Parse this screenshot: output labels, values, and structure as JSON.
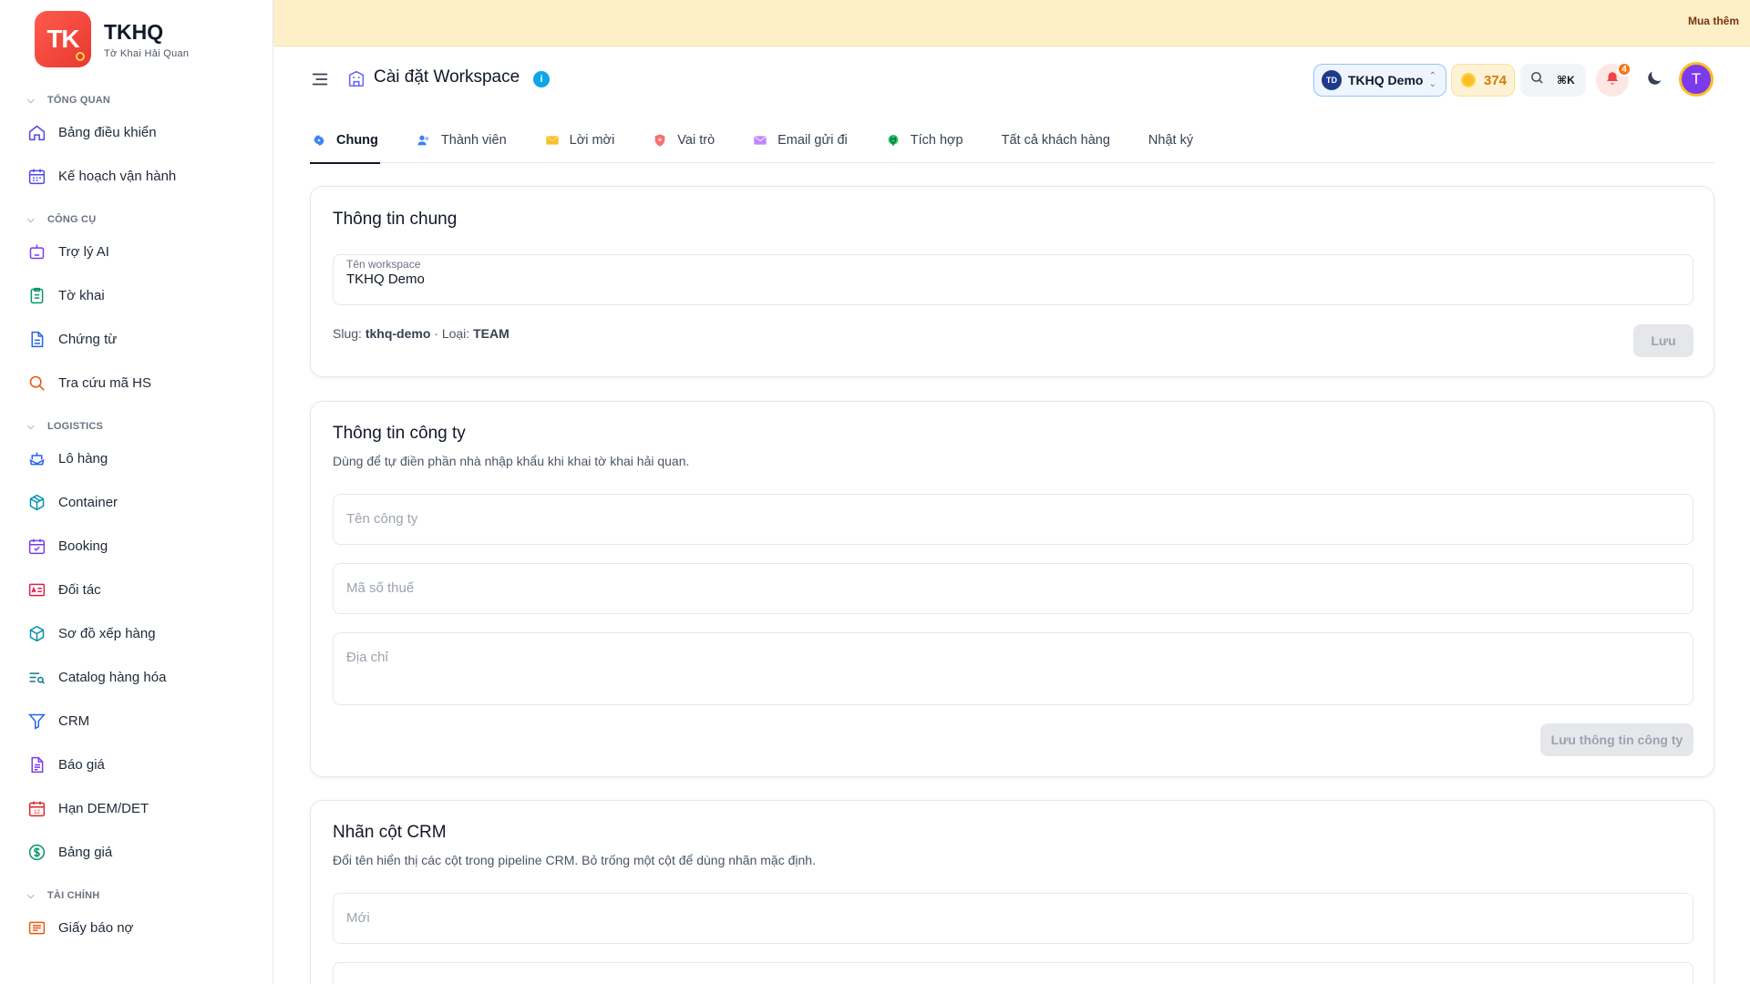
{
  "brand": {
    "logo_text": "TK",
    "name": "TKHQ",
    "subtitle": "Tờ Khai Hải Quan",
    "accent": "#e8392f"
  },
  "sidebar": {
    "groups": [
      {
        "title": "TỔNG QUAN",
        "items": [
          {
            "label": "Bảng điều khiển",
            "icon": "home-icon"
          },
          {
            "label": "Kế hoạch vận hành",
            "icon": "calendar-icon"
          }
        ]
      },
      {
        "title": "CÔNG CỤ",
        "items": [
          {
            "label": "Trợ lý AI",
            "icon": "robot-icon"
          },
          {
            "label": "Tờ khai",
            "icon": "clipboard-icon"
          },
          {
            "label": "Chứng từ",
            "icon": "document-icon"
          },
          {
            "label": "Tra cứu mã HS",
            "icon": "search-icon"
          }
        ]
      },
      {
        "title": "LOGISTICS",
        "items": [
          {
            "label": "Lô hàng",
            "icon": "ship-icon"
          },
          {
            "label": "Container",
            "icon": "box-icon"
          },
          {
            "label": "Booking",
            "icon": "calendar-check-icon"
          },
          {
            "label": "Đối tác",
            "icon": "id-card-icon"
          },
          {
            "label": "Sơ đồ xếp hàng",
            "icon": "cube-icon"
          },
          {
            "label": "Catalog hàng hóa",
            "icon": "list-search-icon"
          },
          {
            "label": "CRM",
            "icon": "funnel-icon"
          },
          {
            "label": "Báo giá",
            "icon": "file-text-icon"
          },
          {
            "label": "Hạn DEM/DET",
            "icon": "calendar-12-icon"
          },
          {
            "label": "Bảng giá",
            "icon": "dollar-circle-icon"
          }
        ]
      },
      {
        "title": "TÀI CHÍNH",
        "items": [
          {
            "label": "Giấy báo nợ",
            "icon": "receipt-icon"
          }
        ]
      }
    ]
  },
  "banner": {
    "buy_label": "Mua thêm"
  },
  "header": {
    "title": "Cài đặt Workspace",
    "workspace": {
      "initials": "TD",
      "name": "TKHQ Demo"
    },
    "credits": "374",
    "search_shortcut": "⌘K",
    "notifications_count": "4",
    "user_initial": "T"
  },
  "tabs": [
    {
      "label": "Chung",
      "icon": "gear-icon",
      "active": true
    },
    {
      "label": "Thành viên",
      "icon": "users-icon"
    },
    {
      "label": "Lời mời",
      "icon": "envelope-icon"
    },
    {
      "label": "Vai trò",
      "icon": "shield-icon"
    },
    {
      "label": "Email gửi đi",
      "icon": "mail-icon"
    },
    {
      "label": "Tích hợp",
      "icon": "plug-icon"
    },
    {
      "label": "Tất cả khách hàng",
      "icon": ""
    },
    {
      "label": "Nhật ký",
      "icon": ""
    }
  ],
  "general": {
    "title": "Thông tin chung",
    "workspace_name_label": "Tên workspace",
    "workspace_name_value": "TKHQ Demo",
    "slug_label": "Slug:",
    "slug_value": "tkhq-demo",
    "type_label": "· Loại:",
    "type_value": "TEAM",
    "save_label": "Lưu"
  },
  "company": {
    "title": "Thông tin công ty",
    "description": "Dùng để tự điền phần nhà nhập khẩu khi khai tờ khai hải quan.",
    "name_placeholder": "Tên công ty",
    "tax_placeholder": "Mã số thuế",
    "address_placeholder": "Địa chỉ",
    "save_label": "Lưu thông tin công ty"
  },
  "crm": {
    "title": "Nhãn cột CRM",
    "description": "Đổi tên hiển thị các cột trong pipeline CRM. Bỏ trống một cột để dùng nhãn mặc định.",
    "new_placeholder": "Mới"
  }
}
